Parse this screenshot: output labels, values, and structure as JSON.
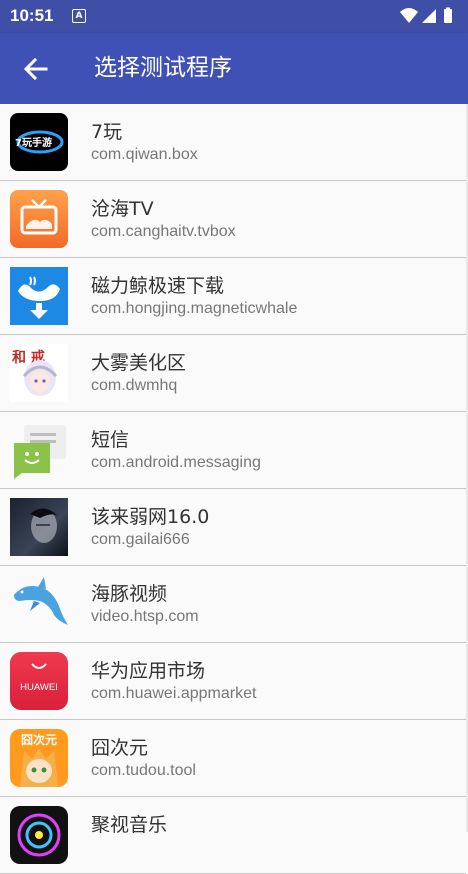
{
  "status_bar": {
    "time": "10:51",
    "notification_glyph": "A",
    "icons": [
      "wifi-icon",
      "signal-icon",
      "battery-icon"
    ]
  },
  "toolbar": {
    "back_icon": "arrow-left-icon",
    "title": "选择测试程序",
    "color": "#3f51b5"
  },
  "apps": [
    {
      "name": "7玩",
      "package": "com.qiwan.box",
      "icon": "qiwan-icon"
    },
    {
      "name": "沧海TV",
      "package": "com.canghaitv.tvbox",
      "icon": "canghai-tv-icon"
    },
    {
      "name": "磁力鲸极速下载",
      "package": "com.hongjing.magneticwhale",
      "icon": "whale-download-icon"
    },
    {
      "name": "大雾美化区",
      "package": "com.dwmhq",
      "icon": "anime-girl-icon"
    },
    {
      "name": "短信",
      "package": "com.android.messaging",
      "icon": "messaging-icon"
    },
    {
      "name": "该来弱网16.0",
      "package": "com.gailai666",
      "icon": "dark-portrait-icon"
    },
    {
      "name": "海豚视频",
      "package": "video.htsp.com",
      "icon": "dolphin-icon"
    },
    {
      "name": "华为应用市场",
      "package": "com.huawei.appmarket",
      "icon": "huawei-appgallery-icon"
    },
    {
      "name": "囧次元",
      "package": "com.tudou.tool",
      "icon": "jiongciyuan-icon"
    },
    {
      "name": "聚视音乐",
      "package": "",
      "icon": "music-disc-icon"
    }
  ],
  "icon_text": {
    "qiwan": "7玩手游",
    "huawei": "HUAWEI",
    "jiong": "囧次元",
    "dawu": "和 戒"
  }
}
